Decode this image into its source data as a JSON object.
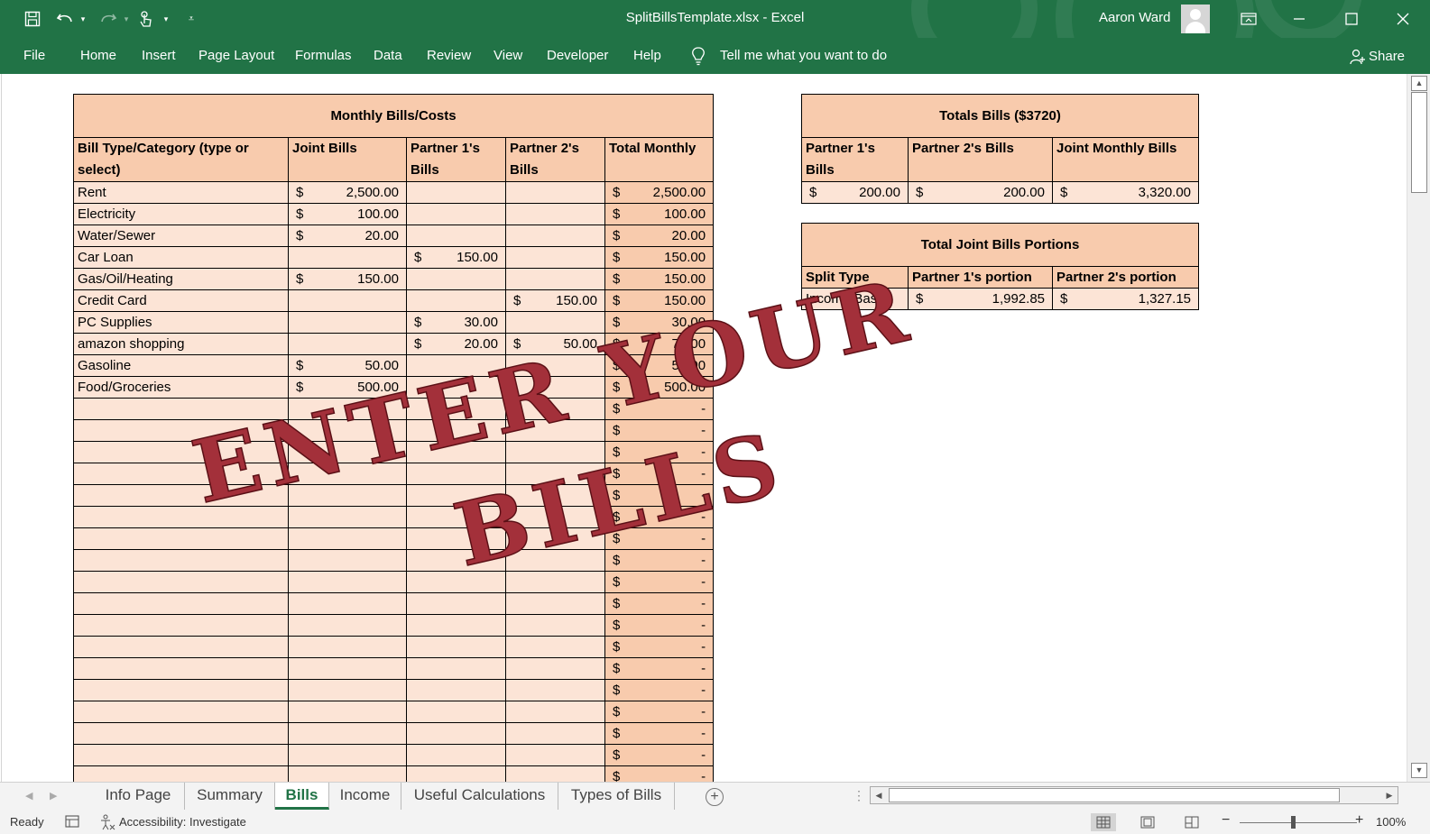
{
  "window": {
    "title": "SplitBillsTemplate.xlsx  -  Excel",
    "user_name": "Aaron Ward"
  },
  "ribbon": {
    "file": "File",
    "tabs": [
      "Home",
      "Insert",
      "Page Layout",
      "Formulas",
      "Data",
      "Review",
      "View",
      "Developer",
      "Help"
    ],
    "tell_me": "Tell me what you want to do",
    "share": "Share"
  },
  "monthly": {
    "title": "Monthly Bills/Costs",
    "headers": {
      "category": "Bill Type/Category (type or select)",
      "joint": "Joint Bills",
      "partner1": "Partner 1's Bills",
      "partner2": "Partner 2's Bills",
      "total": "Total Monthly"
    },
    "currency": "$",
    "rows": [
      {
        "category": "Rent",
        "joint": "2,500.00",
        "p1": "",
        "p2": "",
        "total": "2,500.00"
      },
      {
        "category": "Electricity",
        "joint": "100.00",
        "p1": "",
        "p2": "",
        "total": "100.00"
      },
      {
        "category": "Water/Sewer",
        "joint": "20.00",
        "p1": "",
        "p2": "",
        "total": "20.00"
      },
      {
        "category": "Car Loan",
        "joint": "",
        "p1": "150.00",
        "p2": "",
        "total": "150.00"
      },
      {
        "category": "Gas/Oil/Heating",
        "joint": "150.00",
        "p1": "",
        "p2": "",
        "total": "150.00"
      },
      {
        "category": "Credit Card",
        "joint": "",
        "p1": "",
        "p2": "150.00",
        "total": "150.00"
      },
      {
        "category": "PC Supplies",
        "joint": "",
        "p1": "30.00",
        "p2": "",
        "total": "30.00"
      },
      {
        "category": "amazon shopping",
        "joint": "",
        "p1": "20.00",
        "p2": "50.00",
        "total": "70.00"
      },
      {
        "category": "Gasoline",
        "joint": "50.00",
        "p1": "",
        "p2": "",
        "total": "50.00"
      },
      {
        "category": "Food/Groceries",
        "joint": "500.00",
        "p1": "",
        "p2": "",
        "total": "500.00"
      }
    ],
    "empty_total": "-",
    "empty_row_count": 18
  },
  "totals": {
    "title": "Totals Bills ($3720)",
    "headers": {
      "p1": "Partner 1's Bills",
      "p2": "Partner 2's Bills",
      "joint": "Joint Monthly Bills"
    },
    "values": {
      "p1": "200.00",
      "p2": "200.00",
      "joint": "3,320.00"
    }
  },
  "portions": {
    "title": "Total Joint Bills Portions",
    "headers": {
      "split": "Split Type",
      "p1": "Partner 1's portion",
      "p2": "Partner 2's portion"
    },
    "values": {
      "split": "Income Based",
      "p1": "1,992.85",
      "p2": "1,327.15"
    }
  },
  "stamp": {
    "line1": "ENTER YOUR",
    "line2": "BILLS",
    "color": "#a3303a"
  },
  "sheet_tabs": [
    "Info Page",
    "Summary",
    "Bills",
    "Income",
    "Useful Calculations",
    "Types of Bills"
  ],
  "active_sheet": "Bills",
  "status": {
    "ready": "Ready",
    "accessibility": "Accessibility: Investigate",
    "zoom": "100%"
  },
  "colors": {
    "excel_green": "#217346",
    "header_fill": "#f8cbad",
    "cell_fill": "#fce4d6"
  }
}
